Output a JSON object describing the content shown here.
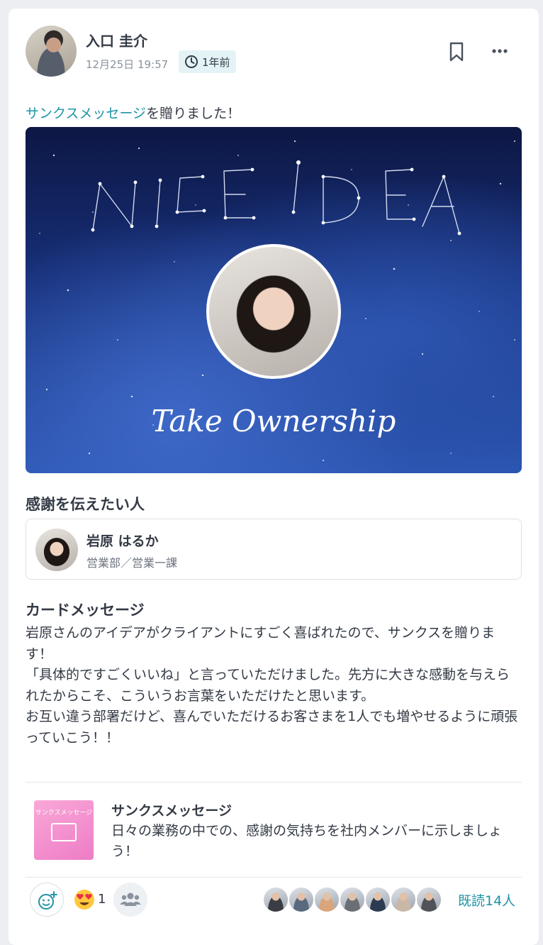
{
  "post": {
    "author_name": "入口 圭介",
    "date": "12月25日 19:57",
    "ago": "1年前",
    "activity_link": "サンクスメッセージ",
    "activity_suffix": "を贈りました！"
  },
  "banner": {
    "constellation_text": "NICE IDEA",
    "value_title": "Take Ownership"
  },
  "recipient": {
    "section_title": "感謝を伝えたい人",
    "name": "岩原 はるか",
    "department": "営業部／営業一課"
  },
  "card_message": {
    "section_title": "カードメッセージ",
    "lines": [
      "岩原さんのアイデアがクライアントにすごく喜ばれたので、サンクスを贈ります！",
      "「具体的ですごくいいね」と言っていただけました。先方に大きな感動を与えられたからこそ、こういうお言葉をいただけたと思います。",
      "お互い違う部署だけど、喜んでいただけるお客さまを1人でも増やせるように頑張っていこう！！"
    ]
  },
  "promo": {
    "thumb_label": "サンクスメッセージ",
    "title": "サンクスメッセージ",
    "description": "日々の業務の中での、感謝の気持ちを社内メンバーに示しましょう！"
  },
  "footer": {
    "reaction_count": "1",
    "read_label": "既読14人",
    "reader_colors": [
      "#3a3d44",
      "#5a6a7e",
      "#d8a57c",
      "#6b6f75",
      "#2c3a52",
      "#c9b8a8",
      "#4f5358"
    ]
  },
  "colors": {
    "accent": "#1f93a6",
    "badge_bg": "#e4f4f6"
  }
}
